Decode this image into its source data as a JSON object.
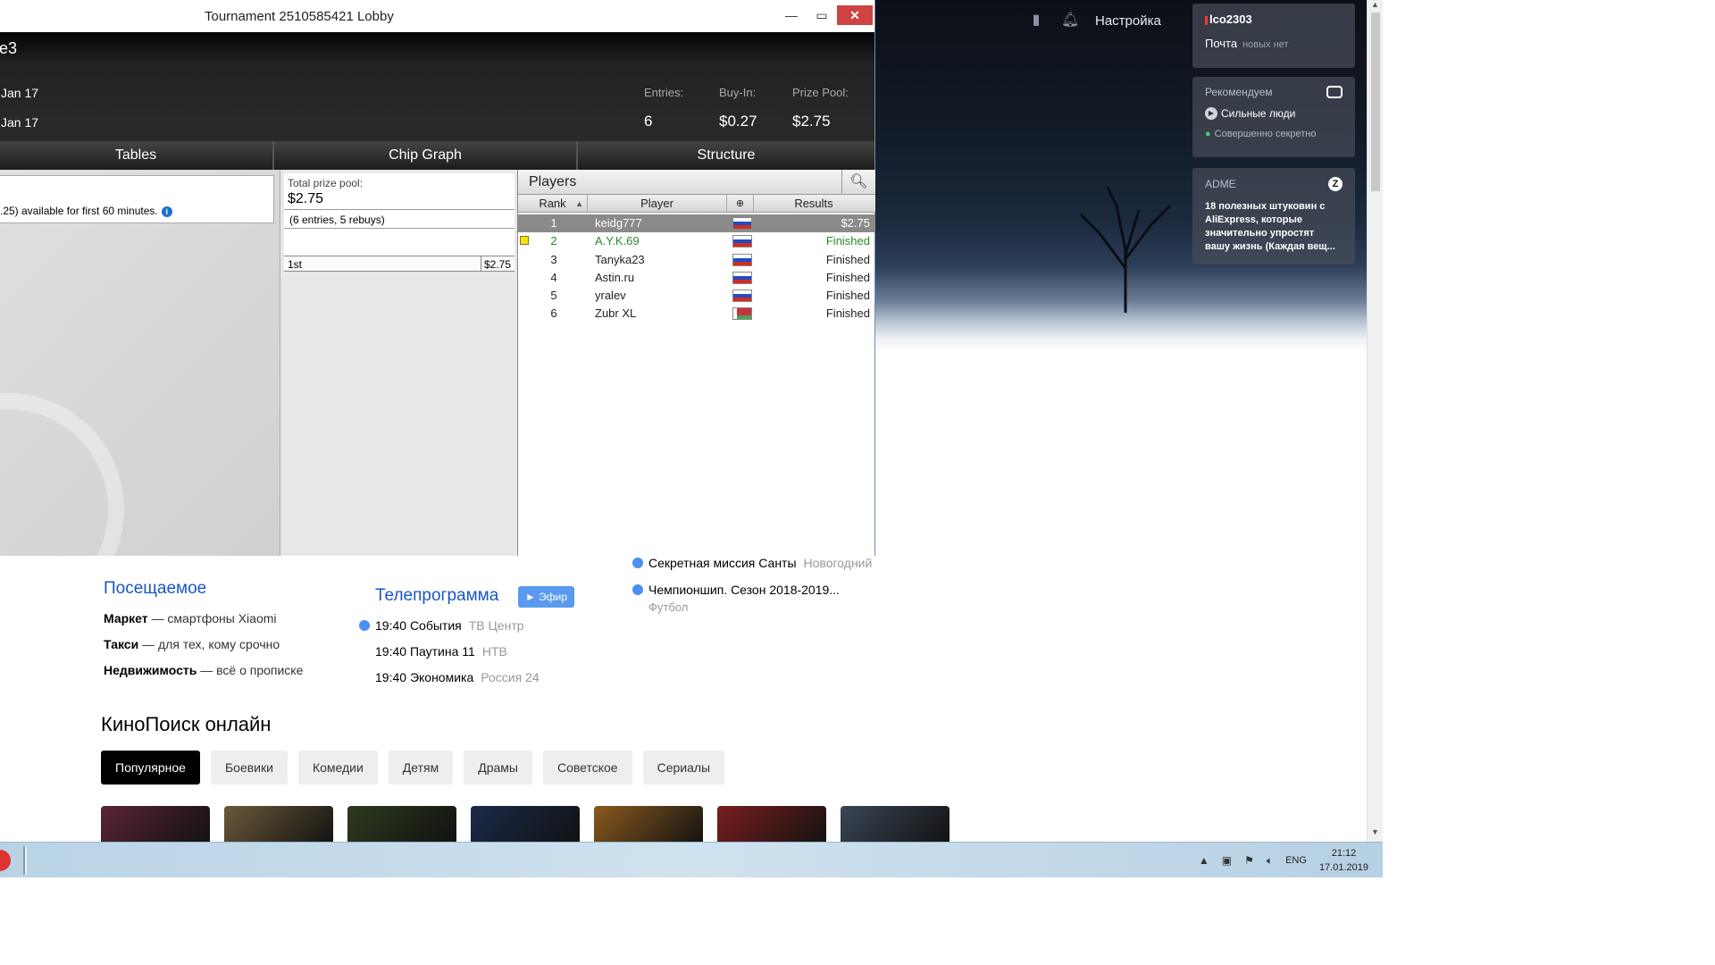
{
  "browser": {
    "top": {
      "settings": "Настройка"
    },
    "widgets": {
      "mail": {
        "user": "lco2303",
        "mail_label": "Почта",
        "mail_status": "новых нет"
      },
      "recommend": {
        "title": "Рекомендуем",
        "show": "Сильные люди",
        "sub": "Совершенно секретно"
      },
      "adme": {
        "title": "ADME",
        "badge": "Z",
        "text": "18 полезных штуковин с AliExpress, которые значительно упростят вашу жизнь (Каждая вещ..."
      }
    },
    "visited": {
      "title": "Посещаемое",
      "items": [
        {
          "name": "Маркет",
          "desc": " — смартфоны Xiaomi"
        },
        {
          "name": "Такси",
          "desc": " — для тех, кому срочно"
        },
        {
          "name": "Недвижимость",
          "desc": " — всё о прописке"
        }
      ]
    },
    "tv": {
      "title": "Телепрограмма",
      "efir": "► Эфир",
      "items": [
        {
          "time": "19:40",
          "show": "События",
          "channel": "ТВ Центр"
        },
        {
          "time": "19:40",
          "show": "Паутина 11",
          "channel": "НТВ"
        },
        {
          "time": "19:40",
          "show": "Экономика",
          "channel": "Россия 24"
        }
      ]
    },
    "news": [
      {
        "title": "Секретная миссия Санты",
        "muted": "Новогодний"
      },
      {
        "title": "Чемпионшип. Сезон 2018-2019...",
        "sub": "Футбол"
      }
    ],
    "kinopoisk": {
      "title": "КиноПоиск онлайн",
      "tabs": [
        "Популярное",
        "Боевики",
        "Комедии",
        "Детям",
        "Драмы",
        "Советское",
        "Сериалы"
      ],
      "poster_colors": [
        "#5a2436",
        "#6a5a3a",
        "#2d3a1e",
        "#1a2a4a",
        "#8a5a1e",
        "#7a1e1e",
        "#3a4656"
      ]
    }
  },
  "taskbar": {
    "lang": "ENG",
    "time": "21:12",
    "date": "17.01.2019"
  },
  "lobby": {
    "window_title": "Tournament 2510585421 Lobby",
    "head": {
      "name": "e3",
      "date1": "Jan 17",
      "date2": "Jan 17",
      "entries_label": "Entries:",
      "buyin_label": "Buy-In:",
      "prize_label": "Prize Pool:",
      "entries": "6",
      "buyin": "$0.27",
      "prize": "$2.75"
    },
    "tabs": {
      "tables": "Tables",
      "chip_graph": "Chip Graph",
      "structure": "Structure"
    },
    "left_info": ".25) available for first 60 minutes.",
    "prize": {
      "label": "Total prize pool:",
      "value": "$2.75",
      "sub": "(6 entries, 5 rebuys)",
      "place": "1st",
      "amount": "$2.75"
    },
    "players": {
      "title": "Players",
      "columns": {
        "rank": "Rank",
        "player": "Player",
        "results": "Results"
      },
      "rows": [
        {
          "rank": "1",
          "name": "keidg777",
          "flag": "ru",
          "result": "$2.75"
        },
        {
          "rank": "2",
          "name": "A.Y.K.69",
          "flag": "ru",
          "result": "Finished"
        },
        {
          "rank": "3",
          "name": "Tanyka23",
          "flag": "ru",
          "result": "Finished"
        },
        {
          "rank": "4",
          "name": "Astin.ru",
          "flag": "ru",
          "result": "Finished"
        },
        {
          "rank": "5",
          "name": "yralev",
          "flag": "ru",
          "result": "Finished"
        },
        {
          "rank": "6",
          "name": "Zubr XL",
          "flag": "by",
          "result": "Finished"
        }
      ]
    }
  }
}
